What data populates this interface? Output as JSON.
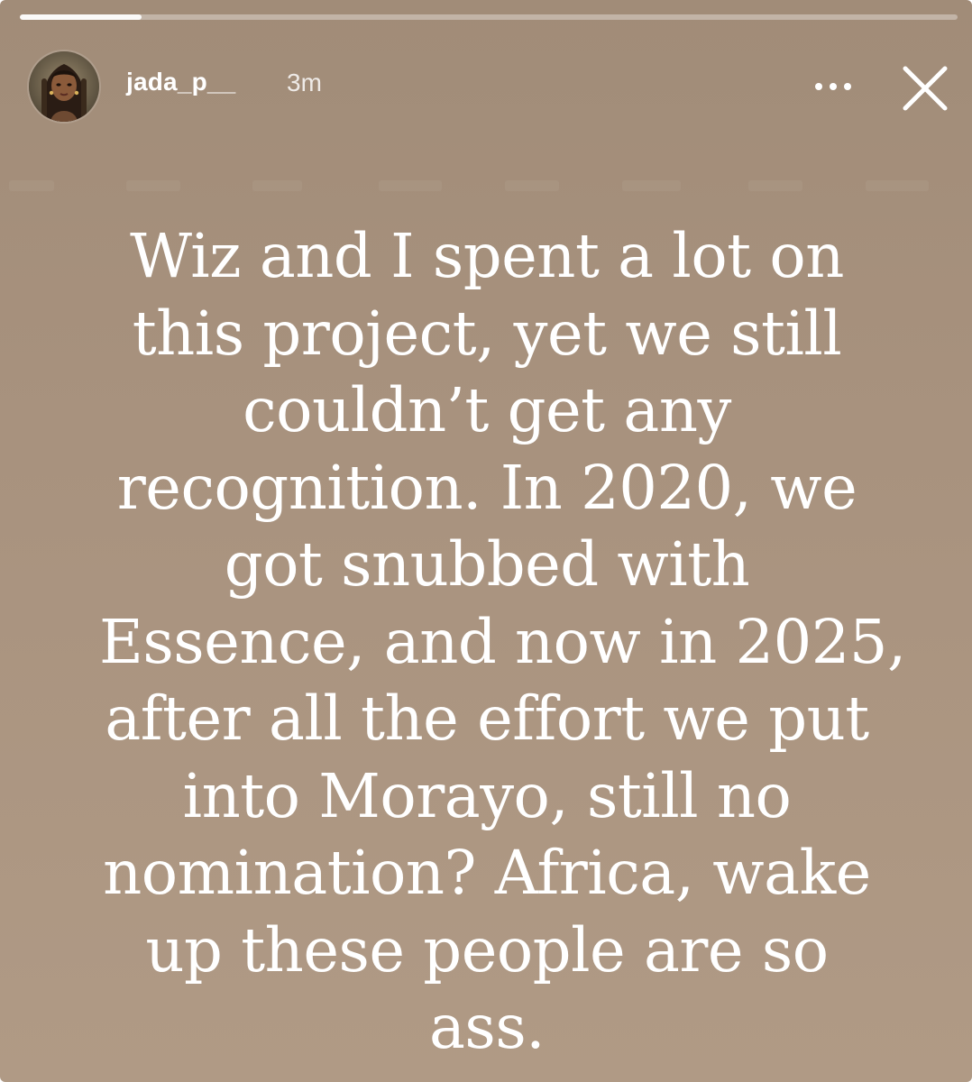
{
  "story": {
    "progress": 0.13,
    "background_color": "#a8927e",
    "header": {
      "avatar_icon": "profile-photo",
      "username": "jada_p__",
      "timestamp": "3m",
      "more_icon": "more-horizontal-icon",
      "close_icon": "close-icon"
    },
    "caption_lines": [
      "Wiz and I spent a lot on",
      "this project, yet we still",
      "couldn’t get any",
      "recognition. In 2020, we",
      "got snubbed with",
      "Essence, and now in 2025,",
      "after all the effort we put",
      "into Morayo, still no",
      "nomination? Africa, wake",
      "up these people are so",
      "ass."
    ]
  }
}
